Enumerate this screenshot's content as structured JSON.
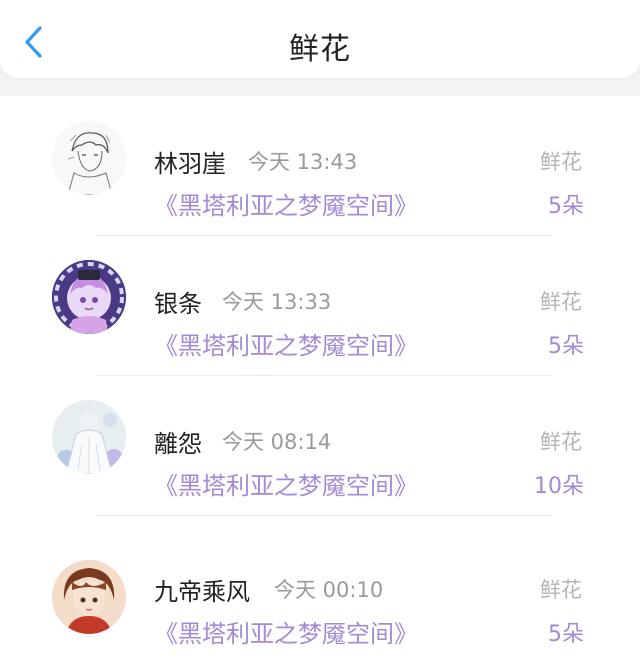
{
  "header": {
    "title": "鲜花",
    "back_icon": "chevron-left-icon",
    "accent": "#2f9bf2"
  },
  "records": [
    {
      "name": "林羽崖",
      "time": "今天 13:43",
      "book": "《黑塔利亚之梦魇空间》",
      "gift": "鲜花",
      "count": "5朵",
      "avatar": "sketch-avatar-icon"
    },
    {
      "name": "银条",
      "time": "今天 13:33",
      "book": "《黑塔利亚之梦魇空间》",
      "gift": "鲜花",
      "count": "5朵",
      "avatar": "purple-chibi-avatar-icon"
    },
    {
      "name": "離怨",
      "time": "今天 08:14",
      "book": "《黑塔利亚之梦魇空间》",
      "gift": "鲜花",
      "count": "10朵",
      "avatar": "white-robe-avatar-icon"
    },
    {
      "name": "九帝乘风",
      "time": "今天 00:10",
      "book": "《黑塔利亚之梦魇空间》",
      "gift": "鲜花",
      "count": "5朵",
      "avatar": "anime-boy-avatar-icon"
    }
  ],
  "colors": {
    "book_link": "#a38ad6",
    "muted": "#9a9a9a",
    "name": "#222222"
  }
}
